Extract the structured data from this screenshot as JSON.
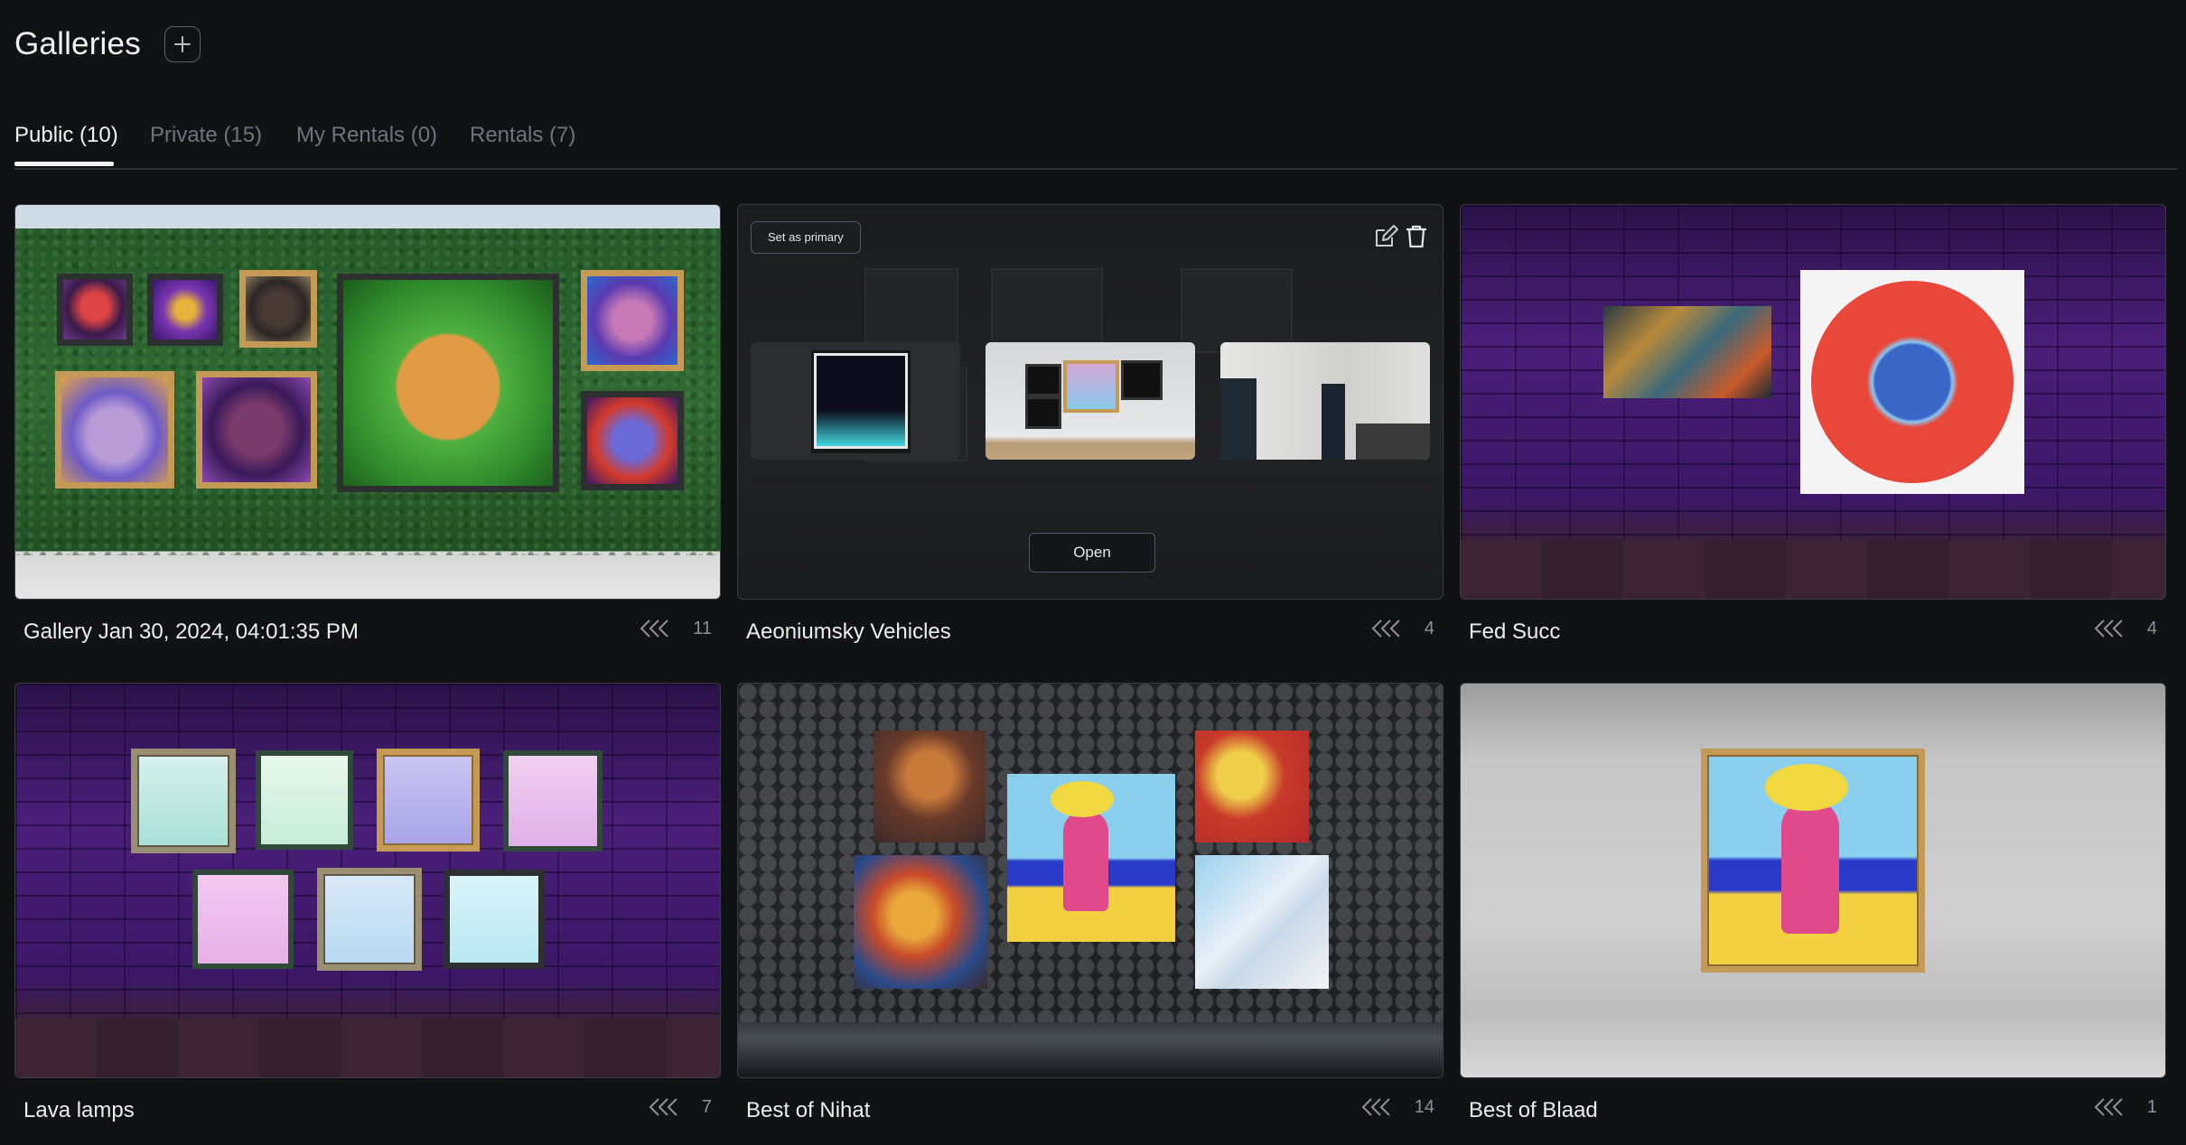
{
  "header": {
    "title": "Galleries",
    "add_icon": "plus-icon"
  },
  "tabs": [
    {
      "label": "Public (10)",
      "active": true
    },
    {
      "label": "Private (15)",
      "active": false
    },
    {
      "label": "My Rentals (0)",
      "active": false
    },
    {
      "label": "Rentals (7)",
      "active": false
    }
  ],
  "actions": {
    "set_primary": "Set as primary",
    "open": "Open",
    "edit_icon": "edit-icon",
    "delete_icon": "trash-icon"
  },
  "galleries": [
    {
      "title": "Gallery Jan 30, 2024, 04:01:35 PM",
      "count": "11"
    },
    {
      "title": "Aeoniumsky Vehicles",
      "count": "4"
    },
    {
      "title": "Fed Succ",
      "count": "4"
    },
    {
      "title": "Lava lamps",
      "count": "7"
    },
    {
      "title": "Best of Nihat",
      "count": "14"
    },
    {
      "title": "Best of Blaad",
      "count": "1"
    }
  ]
}
